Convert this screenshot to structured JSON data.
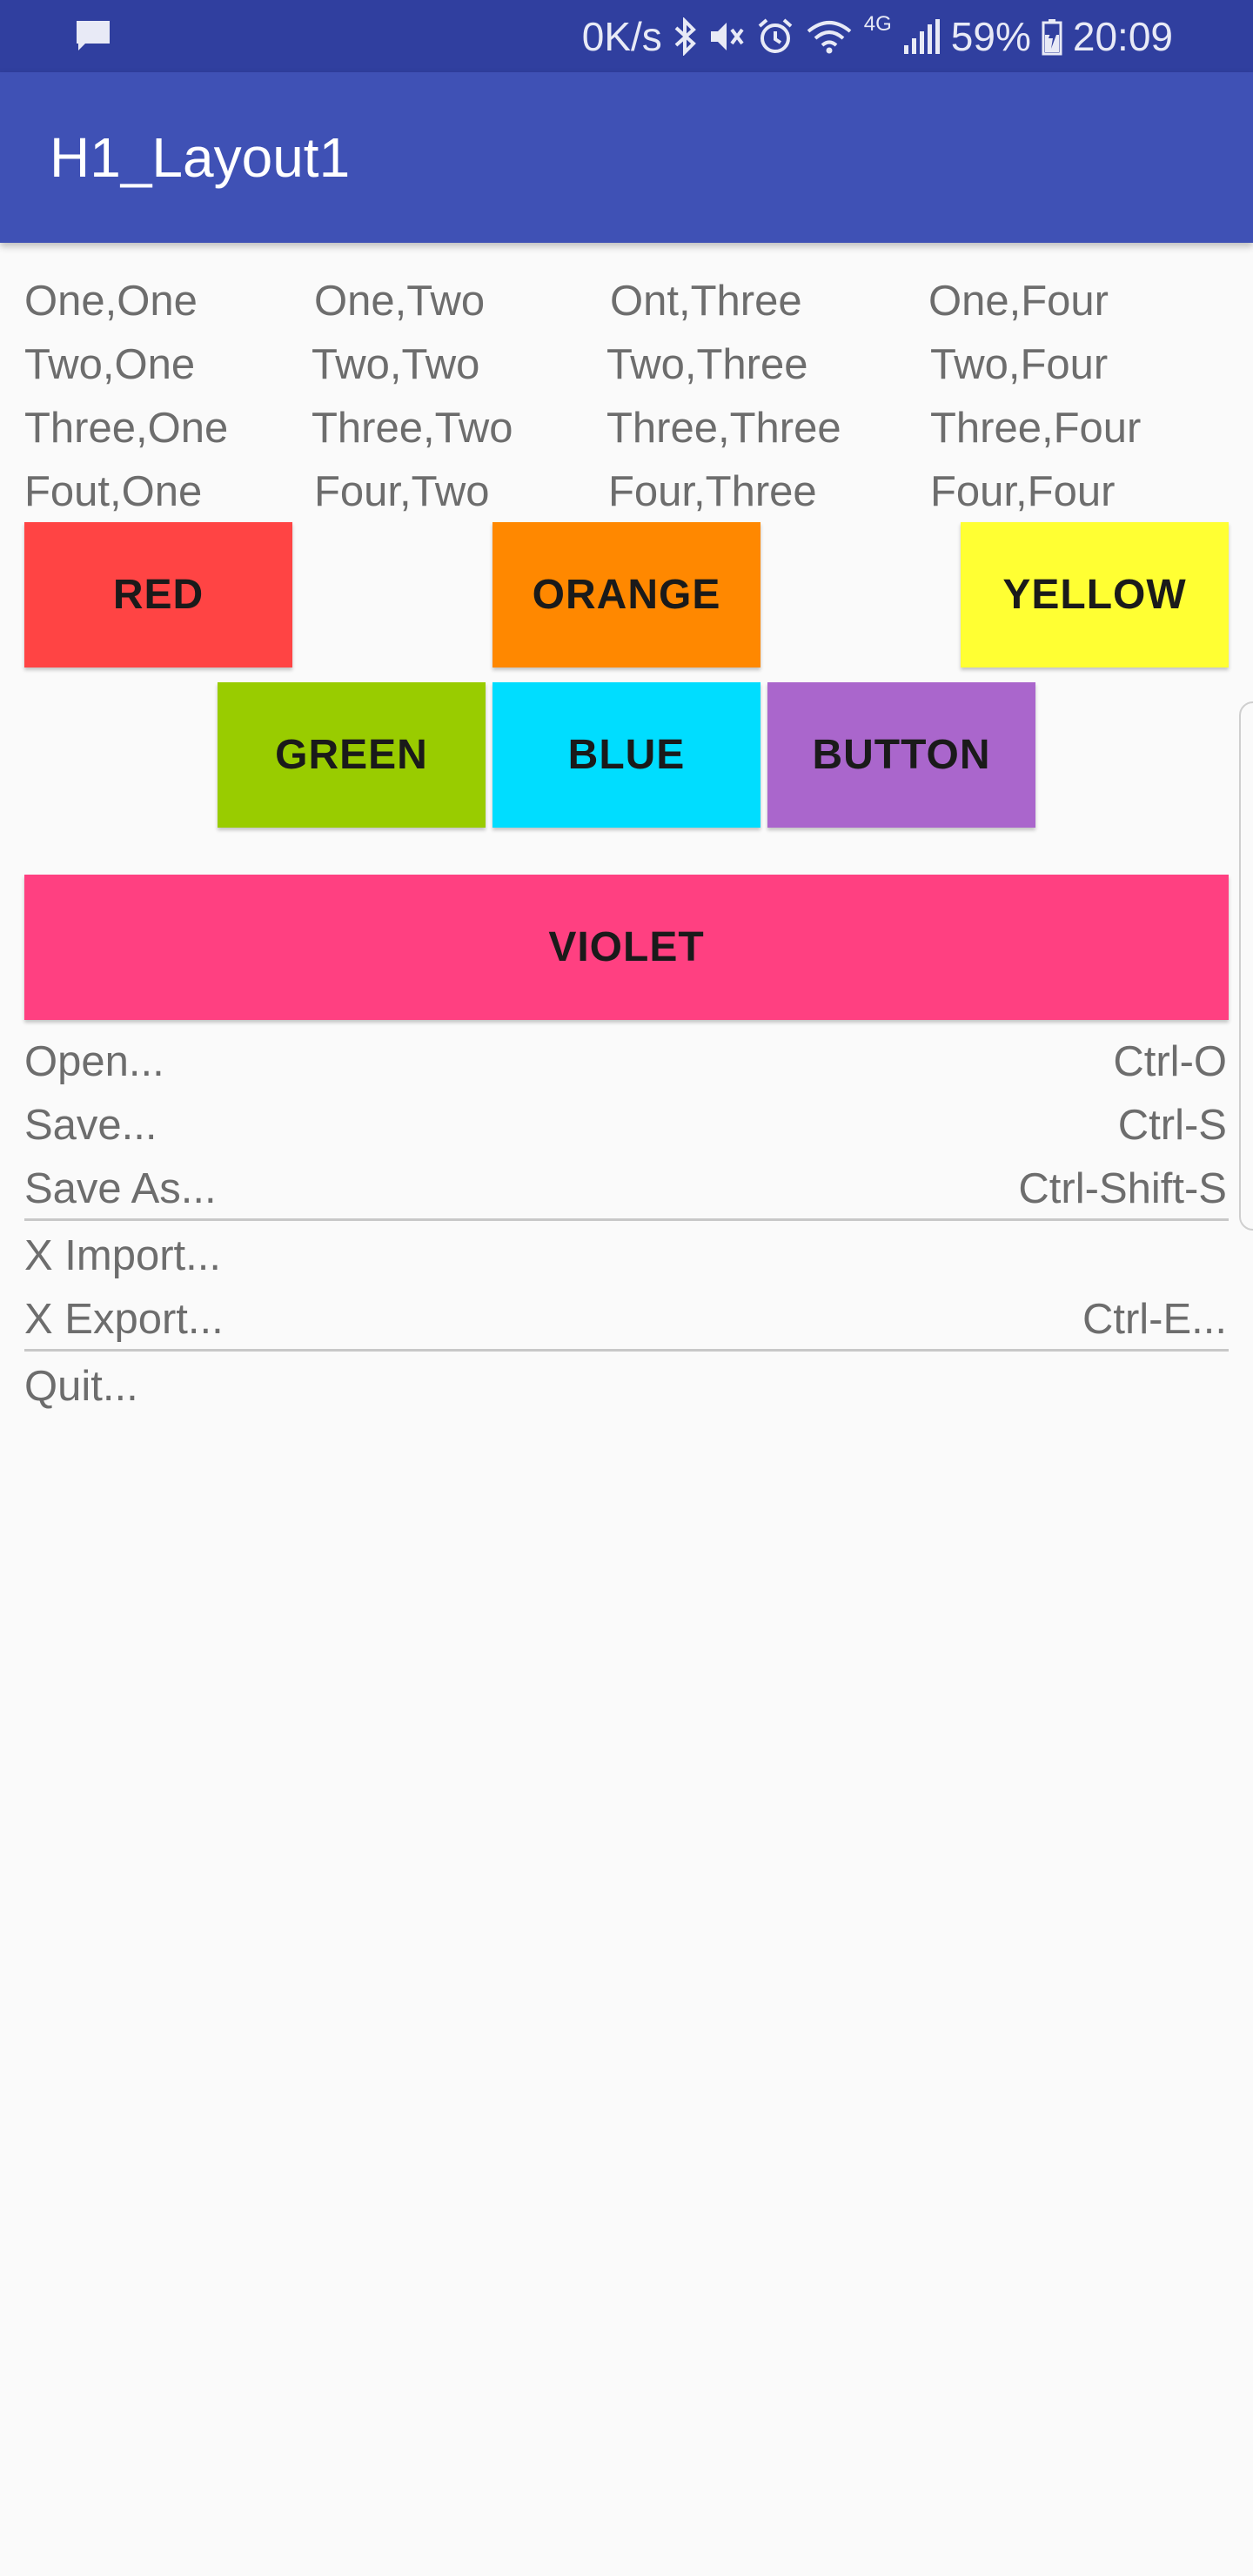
{
  "status_bar": {
    "speed": "0K/s",
    "battery_percent": "59%",
    "time": "20:09",
    "network": "4G",
    "icons": [
      "message-icon",
      "bluetooth-icon",
      "mute-icon",
      "alarm-icon",
      "wifi-icon",
      "signal-icon",
      "battery-icon"
    ]
  },
  "app_bar": {
    "title": "H1_Layout1"
  },
  "table": {
    "rows": [
      [
        "One,One",
        "One,Two",
        "Ont,Three",
        "One,Four"
      ],
      [
        "Two,One",
        "Two,Two",
        "Two,Three",
        "Two,Four"
      ],
      [
        "Three,One",
        "Three,Two",
        "Three,Three",
        "Three,Four"
      ],
      [
        "Fout,One",
        "Four,Two",
        "Four,Three",
        "Four,Four"
      ]
    ]
  },
  "buttons": {
    "red": {
      "label": "RED",
      "color": "#ff4444"
    },
    "orange": {
      "label": "ORANGE",
      "color": "#ff8800"
    },
    "yellow": {
      "label": "YELLOW",
      "color": "#ffff33"
    },
    "green": {
      "label": "GREEN",
      "color": "#99cc00"
    },
    "blue": {
      "label": "BLUE",
      "color": "#00ddff"
    },
    "button": {
      "label": "BUTTON",
      "color": "#aa66cc"
    },
    "violet": {
      "label": "VIOLET",
      "color": "#ff4081"
    }
  },
  "menu": {
    "items": [
      {
        "label": "Open...",
        "shortcut": "Ctrl-O"
      },
      {
        "label": "Save...",
        "shortcut": "Ctrl-S"
      },
      {
        "label": "Save As...",
        "shortcut": "Ctrl-Shift-S"
      },
      {
        "label": "X Import...",
        "shortcut": ""
      },
      {
        "label": "X Export...",
        "shortcut": "Ctrl-E..."
      },
      {
        "label": "Quit...",
        "shortcut": ""
      }
    ]
  }
}
